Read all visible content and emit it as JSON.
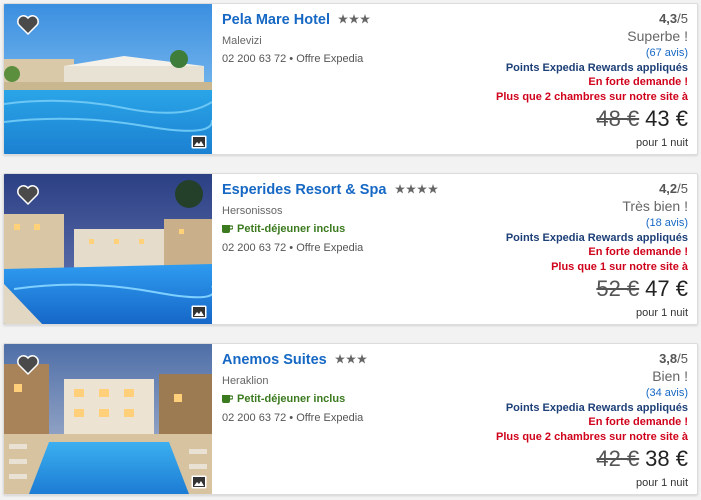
{
  "hotels": [
    {
      "name": "Pela Mare Hotel",
      "stars": 3,
      "location": "Malevizi",
      "breakfast": "",
      "phone_offer": "02 200 63 72 • Offre Expedia",
      "rating_score": "4,3",
      "rating_max": "/5",
      "verdict": "Superbe !",
      "reviews": "(67 avis)",
      "rewards": "Points Expedia Rewards appliqués",
      "demand": "En forte demande !",
      "availability": "Plus que 2 chambres sur notre site à",
      "old_price": "48 €",
      "new_price": "43 €",
      "per_night": "pour 1 nuit"
    },
    {
      "name": "Esperides Resort & Spa",
      "stars": 4,
      "location": "Hersonissos",
      "breakfast": "Petit-déjeuner inclus",
      "phone_offer": "02 200 63 72 • Offre Expedia",
      "rating_score": "4,2",
      "rating_max": "/5",
      "verdict": "Très bien !",
      "reviews": "(18 avis)",
      "rewards": "Points Expedia Rewards appliqués",
      "demand": "En forte demande !",
      "availability": "Plus que 1 sur notre site à",
      "old_price": "52 €",
      "new_price": "47 €",
      "per_night": "pour 1 nuit"
    },
    {
      "name": "Anemos Suites",
      "stars": 3.5,
      "location": "Heraklion",
      "breakfast": "Petit-déjeuner inclus",
      "phone_offer": "02 200 63 72 • Offre Expedia",
      "rating_score": "3,8",
      "rating_max": "/5",
      "verdict": "Bien !",
      "reviews": "(34 avis)",
      "rewards": "Points Expedia Rewards appliqués",
      "demand": "En forte demande !",
      "availability": "Plus que 2 chambres sur notre site à",
      "old_price": "42 €",
      "new_price": "38 €",
      "per_night": "pour 1 nuit"
    }
  ],
  "icons": {
    "favorite": "heart-icon",
    "gallery": "image-gallery-icon",
    "breakfast": "coffee-cup-icon",
    "star": "star-icon"
  },
  "colors": {
    "link": "#1668c4",
    "rewards": "#1d3f77",
    "urgent": "#d0021b",
    "breakfast": "#3b7a1e"
  }
}
